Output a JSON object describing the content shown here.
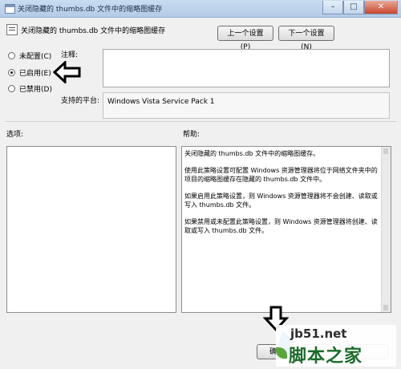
{
  "window": {
    "title": "关闭隐藏的 thumbs.db 文件中的缩略图缓存",
    "minimize_glyph": "–",
    "maximize_glyph": "□",
    "close_glyph": "✕"
  },
  "header": {
    "policy_name": "关闭隐藏的 thumbs.db 文件中的缩略图缓存",
    "prev_button": "上一个设置(P)",
    "next_button": "下一个设置(N)"
  },
  "state": {
    "options": [
      {
        "label": "未配置(C)",
        "checked": false
      },
      {
        "label": "已启用(E)",
        "checked": true
      },
      {
        "label": "已禁用(D)",
        "checked": false
      }
    ]
  },
  "comment": {
    "label": "注释:",
    "value": ""
  },
  "platform": {
    "label": "支持的平台:",
    "value": "Windows Vista Service Pack 1"
  },
  "options_panel": {
    "label": "选项:"
  },
  "help_panel": {
    "label": "帮助:",
    "paragraphs": [
      "关闭隐藏的 thumbs.db 文件中的缩略图缓存。",
      "使用此策略设置可配置 Windows 资源管理器将位于网络文件夹中的项目的缩略图缓存在隐藏的 thumbs.db 文件中。",
      "如果启用此策略设置，则 Windows 资源管理器将不会创建、读取或写入 thumbs.db 文件。",
      "如果禁用或未配置此策略设置，则 Windows 资源管理器将创建、读取或写入 thumbs.db 文件。"
    ]
  },
  "footer": {
    "ok_button": "确定",
    "cancel_button": "",
    "apply_button": ""
  },
  "watermark": {
    "url": "jb51.net",
    "name": "脚本之家"
  },
  "colors": {
    "annotation_arrow": "#000000",
    "pointer_blue": "#1e8fe0",
    "watermark_green": "#1b6b2a"
  },
  "icons": {
    "window": "window-icon",
    "policy": "policy-setting-icon",
    "annotation_left": "arrow-left-annotation-icon",
    "annotation_down": "arrow-down-annotation-icon",
    "pointer": "mouse-pointer-icon"
  }
}
